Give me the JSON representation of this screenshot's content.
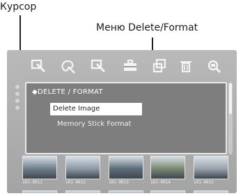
{
  "callouts": {
    "cursor_label": "Курсор",
    "menu_label": "Меню Delete/Format"
  },
  "toolbar": {
    "icons": [
      "magnify-cursor-icon",
      "palette-icon",
      "magnify-cursor-icon",
      "toolbox-icon",
      "copy-icon",
      "trash-icon",
      "zoom-icon"
    ]
  },
  "menu": {
    "title": "◆DELETE / FORMAT",
    "items": [
      "Delete Image",
      "Memory Stick Format"
    ],
    "selected_index": 0
  },
  "thumbnails": {
    "labels": [
      "101-0011",
      "101-0012",
      "101-0013",
      "101-0014",
      "101-0015"
    ],
    "tints": [
      "#6f7f8c",
      "#8e9aa6",
      "#5d6c7a",
      "#7a8a72",
      "#9aa3ad"
    ]
  },
  "colors": {
    "screen_bg": "#b0b0b0",
    "menu_bg": "#7e7e7e",
    "menu_border": "#e8e8e8",
    "selection_bg": "#ffffff",
    "text_light": "#f0f0f0"
  }
}
